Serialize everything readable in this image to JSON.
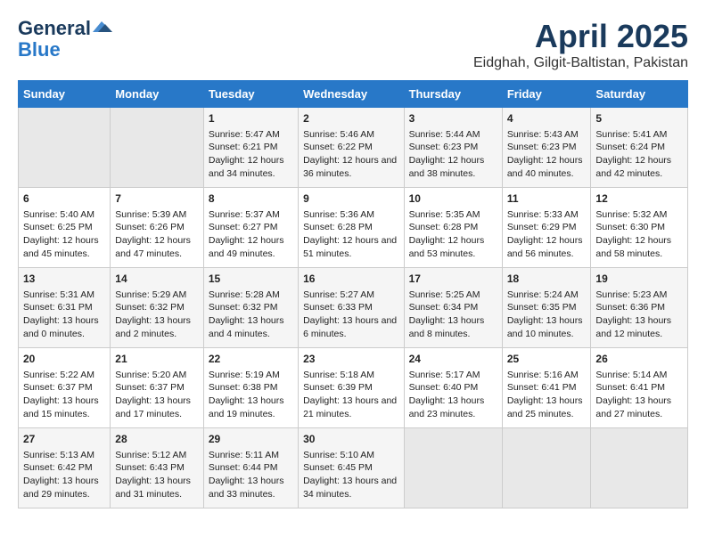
{
  "header": {
    "logo_line1": "General",
    "logo_line2": "Blue",
    "title": "April 2025",
    "subtitle": "Eidghah, Gilgit-Baltistan, Pakistan"
  },
  "days_of_week": [
    "Sunday",
    "Monday",
    "Tuesday",
    "Wednesday",
    "Thursday",
    "Friday",
    "Saturday"
  ],
  "weeks": [
    [
      {
        "day": "",
        "empty": true
      },
      {
        "day": "",
        "empty": true
      },
      {
        "day": "1",
        "sunrise": "Sunrise: 5:47 AM",
        "sunset": "Sunset: 6:21 PM",
        "daylight": "Daylight: 12 hours and 34 minutes."
      },
      {
        "day": "2",
        "sunrise": "Sunrise: 5:46 AM",
        "sunset": "Sunset: 6:22 PM",
        "daylight": "Daylight: 12 hours and 36 minutes."
      },
      {
        "day": "3",
        "sunrise": "Sunrise: 5:44 AM",
        "sunset": "Sunset: 6:23 PM",
        "daylight": "Daylight: 12 hours and 38 minutes."
      },
      {
        "day": "4",
        "sunrise": "Sunrise: 5:43 AM",
        "sunset": "Sunset: 6:23 PM",
        "daylight": "Daylight: 12 hours and 40 minutes."
      },
      {
        "day": "5",
        "sunrise": "Sunrise: 5:41 AM",
        "sunset": "Sunset: 6:24 PM",
        "daylight": "Daylight: 12 hours and 42 minutes."
      }
    ],
    [
      {
        "day": "6",
        "sunrise": "Sunrise: 5:40 AM",
        "sunset": "Sunset: 6:25 PM",
        "daylight": "Daylight: 12 hours and 45 minutes."
      },
      {
        "day": "7",
        "sunrise": "Sunrise: 5:39 AM",
        "sunset": "Sunset: 6:26 PM",
        "daylight": "Daylight: 12 hours and 47 minutes."
      },
      {
        "day": "8",
        "sunrise": "Sunrise: 5:37 AM",
        "sunset": "Sunset: 6:27 PM",
        "daylight": "Daylight: 12 hours and 49 minutes."
      },
      {
        "day": "9",
        "sunrise": "Sunrise: 5:36 AM",
        "sunset": "Sunset: 6:28 PM",
        "daylight": "Daylight: 12 hours and 51 minutes."
      },
      {
        "day": "10",
        "sunrise": "Sunrise: 5:35 AM",
        "sunset": "Sunset: 6:28 PM",
        "daylight": "Daylight: 12 hours and 53 minutes."
      },
      {
        "day": "11",
        "sunrise": "Sunrise: 5:33 AM",
        "sunset": "Sunset: 6:29 PM",
        "daylight": "Daylight: 12 hours and 56 minutes."
      },
      {
        "day": "12",
        "sunrise": "Sunrise: 5:32 AM",
        "sunset": "Sunset: 6:30 PM",
        "daylight": "Daylight: 12 hours and 58 minutes."
      }
    ],
    [
      {
        "day": "13",
        "sunrise": "Sunrise: 5:31 AM",
        "sunset": "Sunset: 6:31 PM",
        "daylight": "Daylight: 13 hours and 0 minutes."
      },
      {
        "day": "14",
        "sunrise": "Sunrise: 5:29 AM",
        "sunset": "Sunset: 6:32 PM",
        "daylight": "Daylight: 13 hours and 2 minutes."
      },
      {
        "day": "15",
        "sunrise": "Sunrise: 5:28 AM",
        "sunset": "Sunset: 6:32 PM",
        "daylight": "Daylight: 13 hours and 4 minutes."
      },
      {
        "day": "16",
        "sunrise": "Sunrise: 5:27 AM",
        "sunset": "Sunset: 6:33 PM",
        "daylight": "Daylight: 13 hours and 6 minutes."
      },
      {
        "day": "17",
        "sunrise": "Sunrise: 5:25 AM",
        "sunset": "Sunset: 6:34 PM",
        "daylight": "Daylight: 13 hours and 8 minutes."
      },
      {
        "day": "18",
        "sunrise": "Sunrise: 5:24 AM",
        "sunset": "Sunset: 6:35 PM",
        "daylight": "Daylight: 13 hours and 10 minutes."
      },
      {
        "day": "19",
        "sunrise": "Sunrise: 5:23 AM",
        "sunset": "Sunset: 6:36 PM",
        "daylight": "Daylight: 13 hours and 12 minutes."
      }
    ],
    [
      {
        "day": "20",
        "sunrise": "Sunrise: 5:22 AM",
        "sunset": "Sunset: 6:37 PM",
        "daylight": "Daylight: 13 hours and 15 minutes."
      },
      {
        "day": "21",
        "sunrise": "Sunrise: 5:20 AM",
        "sunset": "Sunset: 6:37 PM",
        "daylight": "Daylight: 13 hours and 17 minutes."
      },
      {
        "day": "22",
        "sunrise": "Sunrise: 5:19 AM",
        "sunset": "Sunset: 6:38 PM",
        "daylight": "Daylight: 13 hours and 19 minutes."
      },
      {
        "day": "23",
        "sunrise": "Sunrise: 5:18 AM",
        "sunset": "Sunset: 6:39 PM",
        "daylight": "Daylight: 13 hours and 21 minutes."
      },
      {
        "day": "24",
        "sunrise": "Sunrise: 5:17 AM",
        "sunset": "Sunset: 6:40 PM",
        "daylight": "Daylight: 13 hours and 23 minutes."
      },
      {
        "day": "25",
        "sunrise": "Sunrise: 5:16 AM",
        "sunset": "Sunset: 6:41 PM",
        "daylight": "Daylight: 13 hours and 25 minutes."
      },
      {
        "day": "26",
        "sunrise": "Sunrise: 5:14 AM",
        "sunset": "Sunset: 6:41 PM",
        "daylight": "Daylight: 13 hours and 27 minutes."
      }
    ],
    [
      {
        "day": "27",
        "sunrise": "Sunrise: 5:13 AM",
        "sunset": "Sunset: 6:42 PM",
        "daylight": "Daylight: 13 hours and 29 minutes."
      },
      {
        "day": "28",
        "sunrise": "Sunrise: 5:12 AM",
        "sunset": "Sunset: 6:43 PM",
        "daylight": "Daylight: 13 hours and 31 minutes."
      },
      {
        "day": "29",
        "sunrise": "Sunrise: 5:11 AM",
        "sunset": "Sunset: 6:44 PM",
        "daylight": "Daylight: 13 hours and 33 minutes."
      },
      {
        "day": "30",
        "sunrise": "Sunrise: 5:10 AM",
        "sunset": "Sunset: 6:45 PM",
        "daylight": "Daylight: 13 hours and 34 minutes."
      },
      {
        "day": "",
        "empty": true
      },
      {
        "day": "",
        "empty": true
      },
      {
        "day": "",
        "empty": true
      }
    ]
  ]
}
